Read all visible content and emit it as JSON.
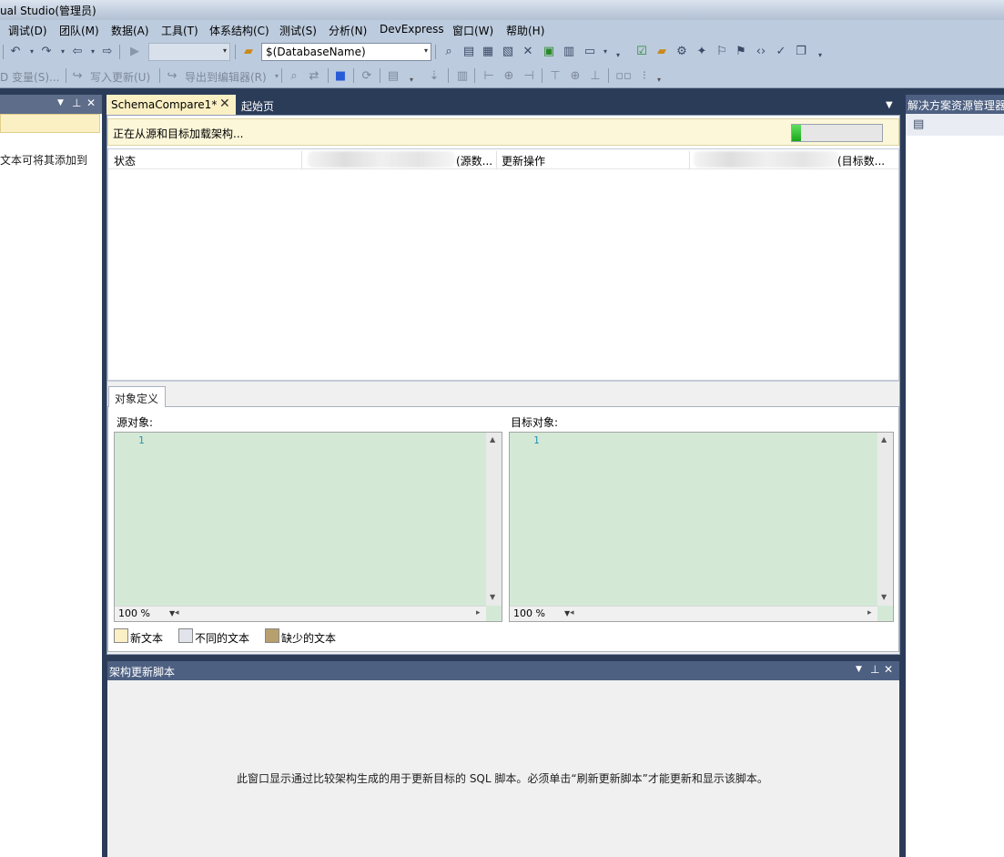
{
  "window": {
    "title": "ual Studio(管理员)"
  },
  "menu": [
    "调试(D)",
    "团队(M)",
    "数据(A)",
    "工具(T)",
    "体系结构(C)",
    "测试(S)",
    "分析(N)",
    "DevExpress",
    "窗口(W)",
    "帮助(H)"
  ],
  "toolbar1": {
    "database_combo": "$(DatabaseName)",
    "config_combo": ""
  },
  "toolbar2": {
    "variables_button": "D 变量(S)...",
    "write_updates_button": "写入更新(U)",
    "export_editor_button": "导出到编辑器(R)"
  },
  "left_panel": {
    "hint_text": "文本可将其添加到"
  },
  "tabs": [
    {
      "label": "SchemaCompare1*",
      "active": true
    },
    {
      "label": "起始页",
      "active": false
    }
  ],
  "status": {
    "loading_text": "正在从源和目标加载架构...",
    "progress": 0.1
  },
  "grid": {
    "columns": [
      "状态",
      "(源数...",
      "更新操作",
      "(目标数..."
    ]
  },
  "object_definition": {
    "tab_label": "对象定义",
    "source_label": "源对象:",
    "target_label": "目标对象:",
    "source_editor": {
      "line_number": "1",
      "zoom": "100 %"
    },
    "target_editor": {
      "line_number": "1",
      "zoom": "100 %"
    },
    "legend": [
      {
        "label": "新文本",
        "color": "#fbefc6"
      },
      {
        "label": "不同的文本",
        "color": "#e1e4ea"
      },
      {
        "label": "缺少的文本",
        "color": "#b89f6e"
      }
    ]
  },
  "update_script_panel": {
    "title": "架构更新脚本",
    "message": "此窗口显示通过比较架构生成的用于更新目标的 SQL 脚本。必须单击“刷新更新脚本”才能更新和显示该脚本。"
  },
  "right_panel": {
    "title": "解决方案资源管理器"
  },
  "colors": {
    "dock_background": "#2b3c59",
    "panel_header": "#4d6082",
    "editor_background": "#d3e9d6",
    "info_bar": "#fcf7d9",
    "progress_fill": "#1aa71a"
  }
}
